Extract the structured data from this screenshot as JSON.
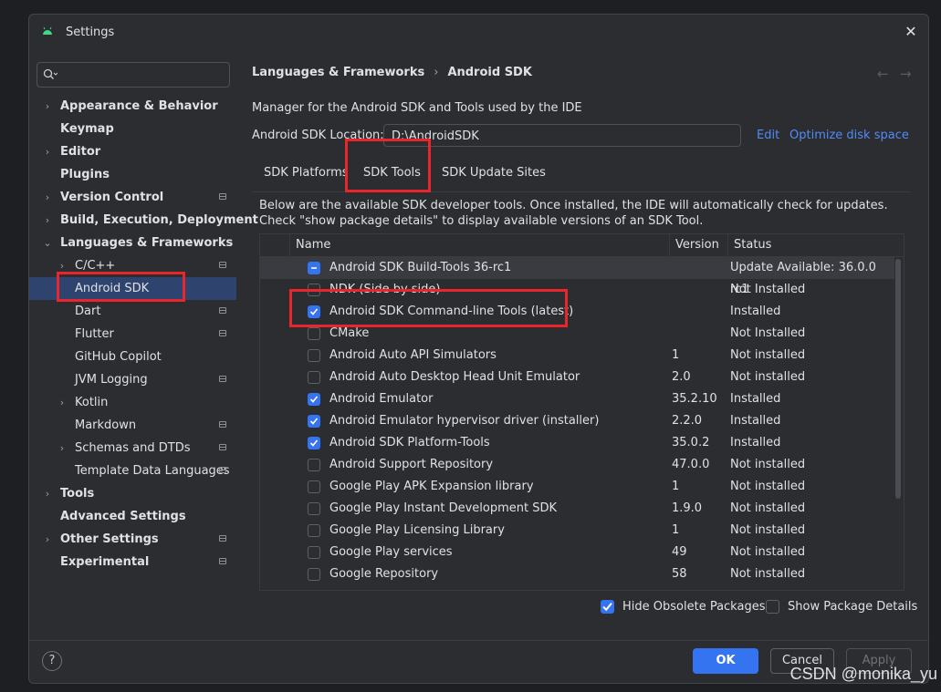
{
  "window": {
    "title": "Settings",
    "close": "✕"
  },
  "sidebar": {
    "search_placeholder": "",
    "items": [
      {
        "label": "Appearance & Behavior",
        "bold": true,
        "chevron": "›",
        "indent": 0,
        "badge": false
      },
      {
        "label": "Keymap",
        "bold": true,
        "chevron": "",
        "indent": 0,
        "badge": false
      },
      {
        "label": "Editor",
        "bold": true,
        "chevron": "›",
        "indent": 0,
        "badge": false
      },
      {
        "label": "Plugins",
        "bold": true,
        "chevron": "",
        "indent": 0,
        "badge": false
      },
      {
        "label": "Version Control",
        "bold": true,
        "chevron": "›",
        "indent": 0,
        "badge": true
      },
      {
        "label": "Build, Execution, Deployment",
        "bold": true,
        "chevron": "›",
        "indent": 0,
        "badge": false
      },
      {
        "label": "Languages & Frameworks",
        "bold": true,
        "chevron": "⌄",
        "indent": 0,
        "badge": false
      },
      {
        "label": "C/C++",
        "bold": false,
        "chevron": "›",
        "indent": 1,
        "badge": true
      },
      {
        "label": "Android SDK",
        "bold": false,
        "chevron": "",
        "indent": 1,
        "badge": false,
        "selected": true
      },
      {
        "label": "Dart",
        "bold": false,
        "chevron": "",
        "indent": 1,
        "badge": true
      },
      {
        "label": "Flutter",
        "bold": false,
        "chevron": "",
        "indent": 1,
        "badge": true
      },
      {
        "label": "GitHub Copilot",
        "bold": false,
        "chevron": "",
        "indent": 1,
        "badge": false
      },
      {
        "label": "JVM Logging",
        "bold": false,
        "chevron": "",
        "indent": 1,
        "badge": true
      },
      {
        "label": "Kotlin",
        "bold": false,
        "chevron": "›",
        "indent": 1,
        "badge": false
      },
      {
        "label": "Markdown",
        "bold": false,
        "chevron": "",
        "indent": 1,
        "badge": true
      },
      {
        "label": "Schemas and DTDs",
        "bold": false,
        "chevron": "›",
        "indent": 1,
        "badge": true
      },
      {
        "label": "Template Data Languages",
        "bold": false,
        "chevron": "",
        "indent": 1,
        "badge": true
      },
      {
        "label": "Tools",
        "bold": true,
        "chevron": "›",
        "indent": 0,
        "badge": false
      },
      {
        "label": "Advanced Settings",
        "bold": true,
        "chevron": "",
        "indent": 0,
        "badge": false
      },
      {
        "label": "Other Settings",
        "bold": true,
        "chevron": "›",
        "indent": 0,
        "badge": true
      },
      {
        "label": "Experimental",
        "bold": true,
        "chevron": "",
        "indent": 0,
        "badge": true
      }
    ]
  },
  "breadcrumb": {
    "parent": "Languages & Frameworks",
    "separator": "›",
    "current": "Android SDK",
    "back": "←",
    "forward": "→"
  },
  "main": {
    "description": "Manager for the Android SDK and Tools used by the IDE",
    "location_label": "Android SDK Location:",
    "location_value": "D:\\AndroidSDK",
    "edit_link": "Edit",
    "optimize_link": "Optimize disk space",
    "tabs": [
      "SDK Platforms",
      "SDK Tools",
      "SDK Update Sites"
    ],
    "active_tab": "SDK Tools",
    "note": "Below are the available SDK developer tools. Once installed, the IDE will automatically check for updates. Check \"show package details\" to display available versions of an SDK Tool."
  },
  "table": {
    "columns": [
      "Name",
      "Version",
      "Status"
    ],
    "rows": [
      {
        "check": "partial",
        "name": "Android SDK Build-Tools 36-rc1",
        "version": "",
        "status": "Update Available: 36.0.0 rc1",
        "selected": true
      },
      {
        "check": "off",
        "name": "NDK (Side by side)",
        "version": "",
        "status": "Not Installed"
      },
      {
        "check": "on",
        "name": "Android SDK Command-line Tools (latest)",
        "version": "",
        "status": "Installed"
      },
      {
        "check": "off",
        "name": "CMake",
        "version": "",
        "status": "Not Installed"
      },
      {
        "check": "off",
        "name": "Android Auto API Simulators",
        "version": "1",
        "status": "Not installed"
      },
      {
        "check": "off",
        "name": "Android Auto Desktop Head Unit Emulator",
        "version": "2.0",
        "status": "Not installed"
      },
      {
        "check": "on",
        "name": "Android Emulator",
        "version": "35.2.10",
        "status": "Installed"
      },
      {
        "check": "on",
        "name": "Android Emulator hypervisor driver (installer)",
        "version": "2.2.0",
        "status": "Installed"
      },
      {
        "check": "on",
        "name": "Android SDK Platform-Tools",
        "version": "35.0.2",
        "status": "Installed"
      },
      {
        "check": "off",
        "name": "Android Support Repository",
        "version": "47.0.0",
        "status": "Not installed"
      },
      {
        "check": "off",
        "name": "Google Play APK Expansion library",
        "version": "1",
        "status": "Not installed"
      },
      {
        "check": "off",
        "name": "Google Play Instant Development SDK",
        "version": "1.9.0",
        "status": "Not installed"
      },
      {
        "check": "off",
        "name": "Google Play Licensing Library",
        "version": "1",
        "status": "Not installed"
      },
      {
        "check": "off",
        "name": "Google Play services",
        "version": "49",
        "status": "Not installed"
      },
      {
        "check": "off",
        "name": "Google Repository",
        "version": "58",
        "status": "Not installed"
      }
    ]
  },
  "options": {
    "hide_obsolete": {
      "label": "Hide Obsolete Packages",
      "checked": true
    },
    "show_details": {
      "label": "Show Package Details",
      "checked": false
    }
  },
  "footer": {
    "help": "?",
    "ok": "OK",
    "cancel": "Cancel",
    "apply": "Apply"
  },
  "watermark": "CSDN @monika_yu",
  "colors": {
    "accent": "#3574f0",
    "link": "#548af7",
    "highlight_box": "#e8262b",
    "selection": "#2e436e"
  }
}
